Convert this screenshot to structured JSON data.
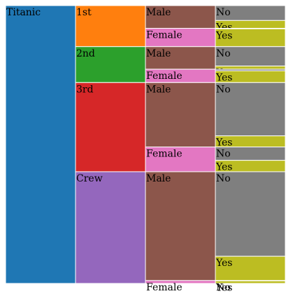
{
  "chart_data": {
    "type": "icicle",
    "title": "",
    "root": {
      "name": "Titanic",
      "color": "#1f77b4",
      "children": [
        {
          "name": "1st",
          "color": "#ff7f0e",
          "children": [
            {
              "name": "Male",
              "color": "#8c564b",
              "children": [
                {
                  "name": "No",
                  "value": 118
                },
                {
                  "name": "Yes",
                  "value": 62
                }
              ]
            },
            {
              "name": "Female",
              "color": "#e377c2",
              "children": [
                {
                  "name": "No",
                  "value": 4
                },
                {
                  "name": "Yes",
                  "value": 141
                }
              ]
            }
          ]
        },
        {
          "name": "2nd",
          "color": "#2ca02c",
          "children": [
            {
              "name": "Male",
              "color": "#8c564b",
              "children": [
                {
                  "name": "No",
                  "value": 154
                },
                {
                  "name": "Yes",
                  "value": 25
                }
              ]
            },
            {
              "name": "Female",
              "color": "#e377c2",
              "children": [
                {
                  "name": "No",
                  "value": 13
                },
                {
                  "name": "Yes",
                  "value": 93
                }
              ]
            }
          ]
        },
        {
          "name": "3rd",
          "color": "#d62728",
          "children": [
            {
              "name": "Male",
              "color": "#8c564b",
              "children": [
                {
                  "name": "No",
                  "value": 422
                },
                {
                  "name": "Yes",
                  "value": 88
                }
              ]
            },
            {
              "name": "Female",
              "color": "#e377c2",
              "children": [
                {
                  "name": "No",
                  "value": 106
                },
                {
                  "name": "Yes",
                  "value": 90
                }
              ]
            }
          ]
        },
        {
          "name": "Crew",
          "color": "#9467bd",
          "children": [
            {
              "name": "Male",
              "color": "#8c564b",
              "children": [
                {
                  "name": "No",
                  "value": 670
                },
                {
                  "name": "Yes",
                  "value": 192
                }
              ]
            },
            {
              "name": "Female",
              "color": "#e377c2",
              "children": [
                {
                  "name": "No",
                  "value": 3
                },
                {
                  "name": "Yes",
                  "value": 20
                }
              ]
            }
          ]
        }
      ]
    },
    "outcome_colors": {
      "No": "#7f7f7f",
      "Yes": "#bcbd22"
    }
  }
}
